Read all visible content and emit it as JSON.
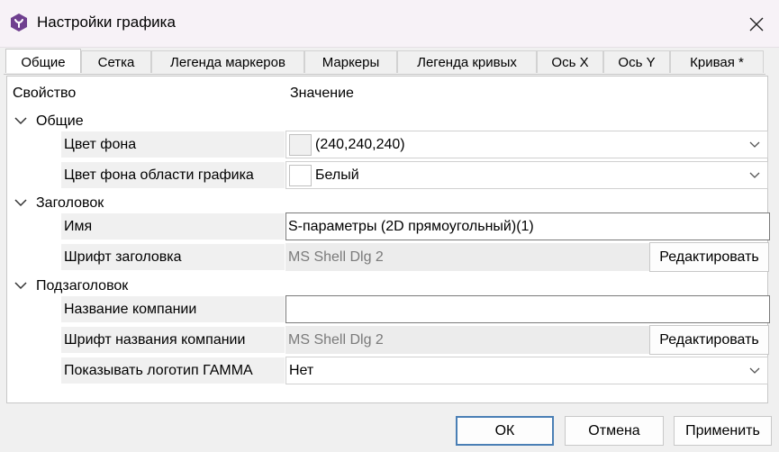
{
  "window": {
    "title": "Настройки графика"
  },
  "tabs": [
    {
      "label": "Общие"
    },
    {
      "label": "Сетка"
    },
    {
      "label": "Легенда маркеров"
    },
    {
      "label": "Маркеры"
    },
    {
      "label": "Легенда кривых"
    },
    {
      "label": "Ось X"
    },
    {
      "label": "Ось Y"
    },
    {
      "label": "Кривая *"
    }
  ],
  "table": {
    "header_property": "Свойство",
    "header_value": "Значение",
    "groups": [
      {
        "label": "Общие",
        "rows": [
          {
            "name": "Цвет фона",
            "value": "(240,240,240)",
            "swatch_color": "#f0f0f0"
          },
          {
            "name": "Цвет фона области графика",
            "value": "Белый",
            "swatch_color": "#ffffff"
          }
        ]
      },
      {
        "label": "Заголовок",
        "rows": [
          {
            "name": "Имя",
            "value": "S-параметры (2D прямоугольный)(1)"
          },
          {
            "name": "Шрифт заголовка",
            "value": "MS Shell Dlg 2",
            "button": "Редактировать"
          }
        ]
      },
      {
        "label": "Подзаголовок",
        "rows": [
          {
            "name": "Название компании",
            "value": ""
          },
          {
            "name": "Шрифт названия компании",
            "value": "MS Shell Dlg 2",
            "button": "Редактировать"
          },
          {
            "name": "Показывать логотип ГАММА",
            "value": "Нет"
          }
        ]
      }
    ]
  },
  "footer": {
    "ok": "ОК",
    "cancel": "Отмена",
    "apply": "Применить"
  },
  "colors": {
    "accent": "#4a7fb5",
    "app_icon": "#6f3f8f"
  }
}
